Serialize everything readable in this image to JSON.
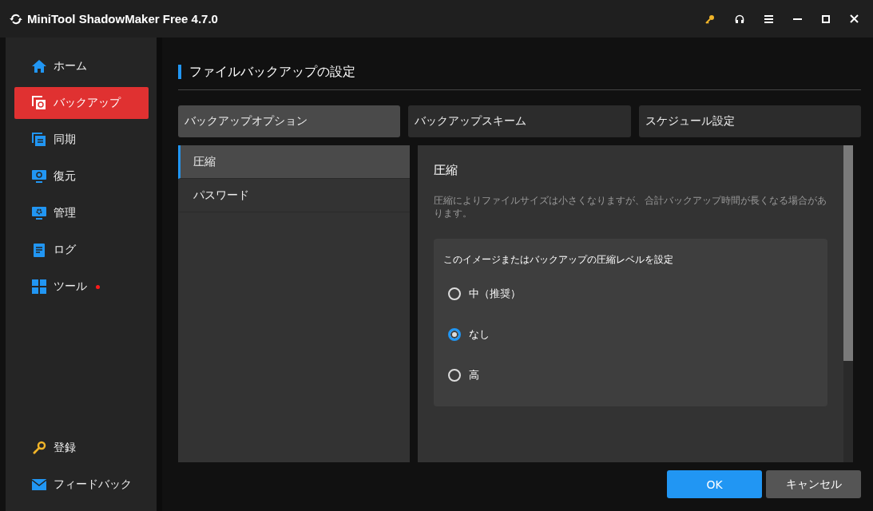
{
  "window": {
    "title": "MiniTool ShadowMaker Free 4.7.0"
  },
  "sidebar": {
    "items": [
      {
        "kind": "home",
        "label": "ホーム",
        "selected": false,
        "dot": false
      },
      {
        "kind": "backup",
        "label": "バックアップ",
        "selected": true,
        "dot": false
      },
      {
        "kind": "sync",
        "label": "同期",
        "selected": false,
        "dot": false
      },
      {
        "kind": "restore",
        "label": "復元",
        "selected": false,
        "dot": false
      },
      {
        "kind": "manage",
        "label": "管理",
        "selected": false,
        "dot": false
      },
      {
        "kind": "log",
        "label": "ログ",
        "selected": false,
        "dot": false
      },
      {
        "kind": "tools",
        "label": "ツール",
        "selected": false,
        "dot": true
      }
    ],
    "bottom_items": [
      {
        "kind": "key",
        "label": "登録"
      },
      {
        "kind": "mail",
        "label": "フィードバック"
      }
    ]
  },
  "heading": "ファイルバックアップの設定",
  "tabs": [
    {
      "label": "バックアップオプション",
      "selected": true
    },
    {
      "label": "バックアップスキーム",
      "selected": false
    },
    {
      "label": "スケジュール設定",
      "selected": false
    }
  ],
  "options": [
    {
      "label": "圧縮",
      "selected": true
    },
    {
      "label": "パスワード",
      "selected": false
    }
  ],
  "detail": {
    "title": "圧縮",
    "description": "圧縮によりファイルサイズは小さくなりますが、合計バックアップ時間が長くなる場合があります。",
    "group_label": "このイメージまたはバックアップの圧縮レベルを設定",
    "choices": [
      {
        "label": "中（推奨）",
        "selected": false
      },
      {
        "label": "なし",
        "selected": true
      },
      {
        "label": "高",
        "selected": false
      }
    ]
  },
  "buttons": [
    {
      "kind": "primary",
      "label": "OK"
    },
    {
      "kind": "secondary",
      "label": "キャンセル"
    }
  ]
}
